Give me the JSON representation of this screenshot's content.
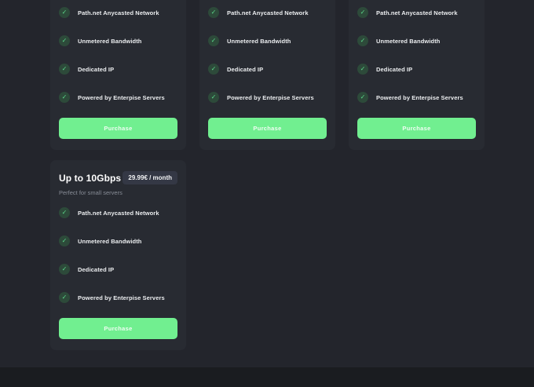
{
  "theme": {
    "page_background": "#23252c",
    "card_background": "#282b32",
    "footer_background": "#1a1c20",
    "accent_green": "#71ef90",
    "check_circle_background": "#2d4a3a",
    "check_mark_color": "#5cd88a",
    "badge_background": "#343845",
    "text_primary": "#ffffff",
    "text_muted": "#878c96"
  },
  "icons": {
    "check": "✓"
  },
  "cards": [
    {
      "features": [
        "Path.net Anycasted Network",
        "Unmetered Bandwidth",
        "Dedicated IP",
        "Powered by Enterpise Servers"
      ],
      "cta": "Purchase"
    },
    {
      "features": [
        "Path.net Anycasted Network",
        "Unmetered Bandwidth",
        "Dedicated IP",
        "Powered by Enterpise Servers"
      ],
      "cta": "Purchase"
    },
    {
      "features": [
        "Path.net Anycasted Network",
        "Unmetered Bandwidth",
        "Dedicated IP",
        "Powered by Enterpise Servers"
      ],
      "cta": "Purchase"
    },
    {
      "title": "Up to 10Gbps",
      "price": "29.99€ / month",
      "subtitle": "Perfect for small servers",
      "features": [
        "Path.net Anycasted Network",
        "Unmetered Bandwidth",
        "Dedicated IP",
        "Powered by Enterpise Servers"
      ],
      "cta": "Purchase"
    }
  ]
}
